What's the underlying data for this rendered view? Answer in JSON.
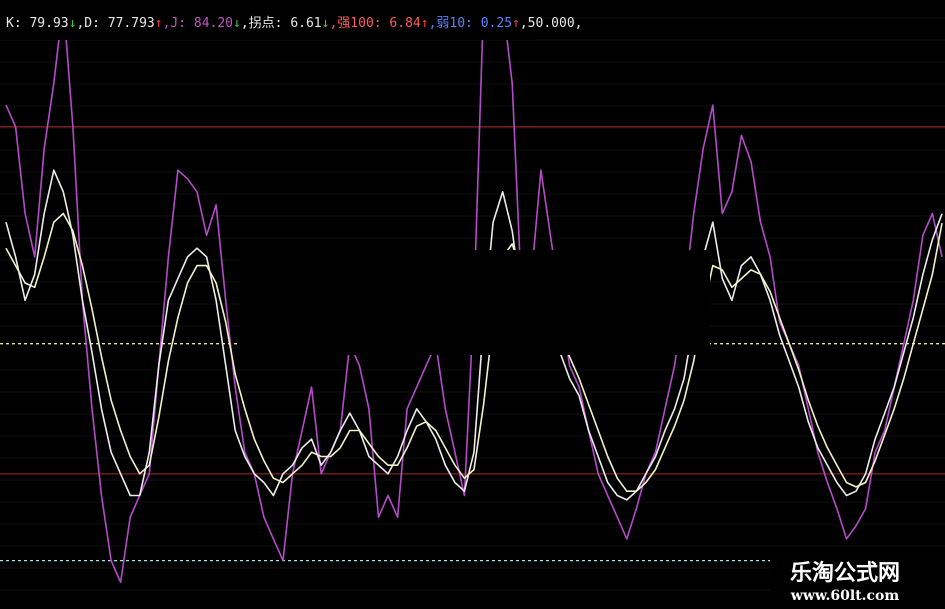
{
  "chart_data": {
    "type": "line",
    "title": "",
    "xlabel": "",
    "ylabel": "",
    "ylim": [
      -10,
      120
    ],
    "grid": true,
    "legend_placement": "top-left",
    "legend": [
      {
        "text": "K: 79.93",
        "arrow": "↓",
        "color": "#e8e8e8",
        "arrow_color": "#3ccf3c"
      },
      {
        "text": ",D: 77.793",
        "arrow": "↑",
        "color": "#e8e8e8",
        "arrow_color": "#ff3b3b"
      },
      {
        "text": ",J: 84.20",
        "arrow": "↓",
        "color": "#c056c0",
        "arrow_color": "#3ccf3c"
      },
      {
        "text": ",拐点: 6.61",
        "arrow": "↓",
        "color": "#e8e8e8",
        "arrow_color": "#3ccf3c"
      },
      {
        "text": ",强100: 6.84",
        "arrow": "↑",
        "color": "#ff5a5a",
        "arrow_color": "#ff3b3b"
      },
      {
        "text": ",弱10: 0.25",
        "arrow": "↑",
        "color": "#5b82ff",
        "arrow_color": "#ff3b3b"
      },
      {
        "text": ",50.000,",
        "arrow": "",
        "color": "#e8e8e8",
        "arrow_color": "#e8e8e8"
      }
    ],
    "reference_lines": [
      {
        "value": 100,
        "style": "solid",
        "color": "#8a1f1f"
      },
      {
        "value": 20,
        "style": "solid",
        "color": "#8a1f1f"
      },
      {
        "value": 50,
        "style": "dotted",
        "color": "#e8e890"
      },
      {
        "value": 0,
        "style": "dotted",
        "color": "#a0e8e8"
      }
    ],
    "series": [
      {
        "name": "",
        "role": "J",
        "color": "#b44bc8",
        "values": [
          105,
          100,
          80,
          70,
          95,
          110,
          150,
          100,
          60,
          35,
          15,
          0,
          -5,
          10,
          15,
          20,
          45,
          70,
          90,
          88,
          85,
          75,
          82,
          60,
          40,
          25,
          20,
          10,
          5,
          0,
          20,
          30,
          40,
          20,
          25,
          30,
          50,
          45,
          35,
          10,
          15,
          10,
          35,
          40,
          45,
          50,
          35,
          25,
          15,
          60,
          130,
          148,
          140,
          110,
          60,
          65,
          90,
          75,
          60,
          45,
          40,
          30,
          20,
          15,
          10,
          5,
          12,
          20,
          25,
          35,
          45,
          60,
          80,
          95,
          105,
          80,
          85,
          98,
          92,
          78,
          70,
          55,
          50,
          45,
          35,
          25,
          18,
          12,
          5,
          8,
          12,
          25,
          30,
          40,
          50,
          60,
          75,
          80,
          70
        ]
      },
      {
        "name": "",
        "role": "K",
        "color": "#ececec",
        "values": [
          78,
          70,
          60,
          66,
          80,
          90,
          85,
          75,
          60,
          48,
          35,
          25,
          20,
          15,
          15,
          25,
          45,
          60,
          65,
          70,
          72,
          70,
          60,
          45,
          30,
          24,
          20,
          18,
          15,
          20,
          22,
          26,
          28,
          22,
          25,
          30,
          34,
          30,
          24,
          22,
          20,
          24,
          30,
          35,
          32,
          28,
          22,
          18,
          16,
          25,
          55,
          78,
          85,
          76,
          60,
          50,
          52,
          55,
          48,
          42,
          38,
          30,
          24,
          18,
          15,
          14,
          16,
          20,
          24,
          30,
          35,
          42,
          55,
          70,
          78,
          65,
          60,
          68,
          70,
          66,
          60,
          52,
          46,
          40,
          32,
          26,
          22,
          18,
          15,
          16,
          20,
          28,
          34,
          40,
          48,
          56,
          66,
          74,
          79.93
        ]
      },
      {
        "name": "",
        "role": "D",
        "color": "#f2f2c8",
        "values": [
          72,
          68,
          64,
          63,
          70,
          78,
          80,
          76,
          68,
          58,
          47,
          37,
          30,
          24,
          20,
          22,
          33,
          46,
          56,
          64,
          68,
          68,
          64,
          55,
          43,
          35,
          28,
          23,
          19,
          18,
          20,
          22,
          25,
          24,
          24,
          26,
          30,
          30,
          27,
          24,
          22,
          22,
          26,
          31,
          32,
          30,
          26,
          22,
          19,
          21,
          36,
          55,
          70,
          73,
          66,
          58,
          55,
          55,
          52,
          47,
          42,
          36,
          30,
          24,
          19,
          16,
          16,
          18,
          21,
          26,
          31,
          37,
          46,
          58,
          68,
          67,
          63,
          65,
          67,
          66,
          62,
          56,
          50,
          44,
          37,
          31,
          26,
          22,
          18,
          17,
          18,
          23,
          29,
          35,
          42,
          50,
          58,
          66,
          77.793
        ]
      }
    ]
  },
  "watermark": {
    "title": "乐淘公式网",
    "url": "www.60lt.com"
  },
  "colors": {
    "background": "#000000",
    "sheet_grid": "#dcdcdc"
  }
}
